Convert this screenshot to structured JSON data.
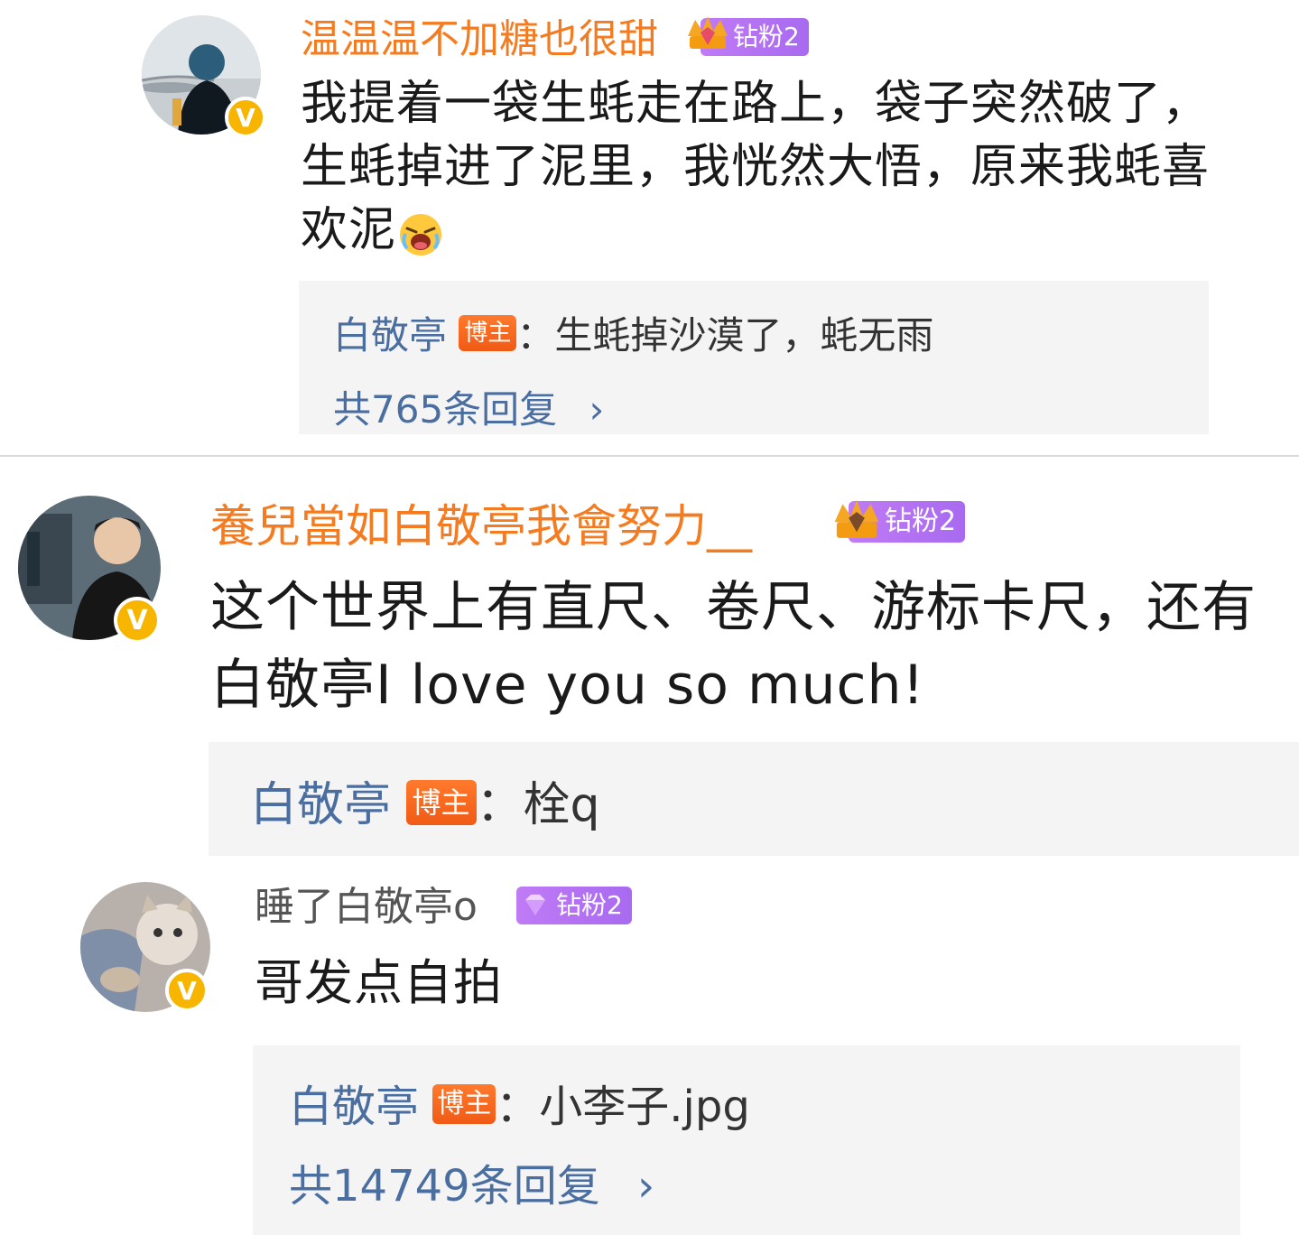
{
  "comments": [
    {
      "username": "温温温不加糖也很甜",
      "fan_badge": "钻粉2",
      "text_lines": [
        "我提着一袋生蚝走在路上，袋子突然破了，",
        "生蚝掉进了泥里，我恍然大悟，原来我蚝喜",
        "欢泥"
      ],
      "emoji": "crying-laugh",
      "reply": {
        "name": "白敬亭",
        "tag": "博主",
        "text": "：生蚝掉沙漠了，蚝无雨"
      },
      "more": "共765条回复"
    },
    {
      "username": "養兒當如白敬亭我會努力__",
      "fan_badge": "钻粉2",
      "text_lines": [
        "这个世界上有直尺、卷尺、游标卡尺，还有",
        "白敬亭I love you so much!"
      ],
      "reply": {
        "name": "白敬亭",
        "tag": "博主",
        "text": "：栓q"
      }
    },
    {
      "username": "睡了白敬亭o",
      "fan_badge": "钻粉2",
      "text_lines": [
        "哥发点自拍"
      ],
      "reply": {
        "name": "白敬亭",
        "tag": "博主",
        "text": "：小李子.jpg"
      },
      "more": "共14749条回复"
    }
  ],
  "verified_mark": "V",
  "more_arrow": "›",
  "colors": {
    "username": "#f57b20",
    "reply_name": "#4a6e9f",
    "fan_badge": "#b274f2",
    "blogger_tag": "#f26a1b",
    "verified": "#f7b500"
  }
}
